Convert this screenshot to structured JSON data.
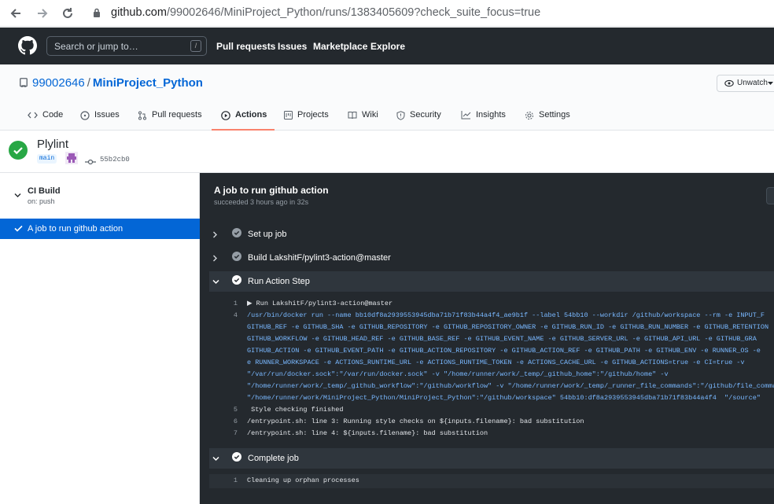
{
  "browser": {
    "url_host": "github.com",
    "url_path": "/99002646/MiniProject_Python/runs/1383405609?check_suite_focus=true"
  },
  "header": {
    "search_placeholder": "Search or jump to…",
    "search_key": "/",
    "nav": [
      "Pull requests",
      "Issues",
      "Marketplace",
      "Explore"
    ]
  },
  "repo": {
    "owner": "99002646",
    "separator": "/",
    "name": "MiniProject_Python",
    "unwatch_label": "Unwatch",
    "tabs": [
      {
        "label": "Code",
        "icon": "code-icon"
      },
      {
        "label": "Issues",
        "icon": "issue-icon"
      },
      {
        "label": "Pull requests",
        "icon": "pull-request-icon"
      },
      {
        "label": "Actions",
        "icon": "play-icon",
        "selected": true
      },
      {
        "label": "Projects",
        "icon": "project-icon"
      },
      {
        "label": "Wiki",
        "icon": "book-icon"
      },
      {
        "label": "Security",
        "icon": "shield-icon"
      },
      {
        "label": "Insights",
        "icon": "graph-icon"
      },
      {
        "label": "Settings",
        "icon": "gear-icon"
      }
    ]
  },
  "run": {
    "title": "Plylint",
    "branch": "main",
    "commit": "55b2cb0"
  },
  "sidebar": {
    "workflow": "CI Build",
    "trigger": "on: push",
    "job": "A job to run github action"
  },
  "job": {
    "title": "A job to run github action",
    "status": "succeeded 3 hours ago in 32s",
    "steps": {
      "setup": "Set up job",
      "build": "Build LakshitF/pylint3-action@master",
      "run": "Run Action Step",
      "complete": "Complete job"
    },
    "run_log": [
      {
        "n": "1",
        "t": "▶ Run LakshitF/pylint3-action@master",
        "cmd": false
      },
      {
        "n": "4",
        "t": "/usr/bin/docker run --name bb10df8a2939553945dba71b71f83b44a4f4_ae9b1f --label 54bb10 --workdir /github/workspace --rm -e INPUT_F",
        "cmd": true
      },
      {
        "n": "",
        "t": "GITHUB_REF -e GITHUB_SHA -e GITHUB_REPOSITORY -e GITHUB_REPOSITORY_OWNER -e GITHUB_RUN_ID -e GITHUB_RUN_NUMBER -e GITHUB_RETENTION",
        "cmd": true
      },
      {
        "n": "",
        "t": "GITHUB_WORKFLOW -e GITHUB_HEAD_REF -e GITHUB_BASE_REF -e GITHUB_EVENT_NAME -e GITHUB_SERVER_URL -e GITHUB_API_URL -e GITHUB_GRA",
        "cmd": true
      },
      {
        "n": "",
        "t": "GITHUB_ACTION -e GITHUB_EVENT_PATH -e GITHUB_ACTION_REPOSITORY -e GITHUB_ACTION_REF -e GITHUB_PATH -e GITHUB_ENV -e RUNNER_OS -e",
        "cmd": true
      },
      {
        "n": "",
        "t": "e RUNNER_WORKSPACE -e ACTIONS_RUNTIME_URL -e ACTIONS_RUNTIME_TOKEN -e ACTIONS_CACHE_URL -e GITHUB_ACTIONS=true -e CI=true -v",
        "cmd": true
      },
      {
        "n": "",
        "t": "\"/var/run/docker.sock\":\"/var/run/docker.sock\" -v \"/home/runner/work/_temp/_github_home\":\"/github/home\" -v",
        "cmd": true
      },
      {
        "n": "",
        "t": "\"/home/runner/work/_temp/_github_workflow\":\"/github/workflow\" -v \"/home/runner/work/_temp/_runner_file_commands\":\"/github/file_comma",
        "cmd": true
      },
      {
        "n": "",
        "t": "\"/home/runner/work/MiniProject_Python/MiniProject_Python\":\"/github/workspace\" 54bb10:df8a2939553945dba71b71f83b44a4f4  \"/source\"",
        "cmd": true
      },
      {
        "n": "5",
        "t": " Style checking finished",
        "cmd": false
      },
      {
        "n": "6",
        "t": "/entrypoint.sh: line 3: Running style checks on ${inputs.filename}: bad substitution",
        "cmd": false
      },
      {
        "n": "7",
        "t": "/entrypoint.sh: line 4: ${inputs.filename}: bad substitution",
        "cmd": false
      }
    ],
    "complete_log": [
      {
        "n": "1",
        "t": "Cleaning up orphan processes"
      }
    ]
  },
  "colors": {
    "success": "#28a745",
    "accent": "#0366d6",
    "header_bg": "#24292e",
    "tab_underline": "#f9826c"
  }
}
